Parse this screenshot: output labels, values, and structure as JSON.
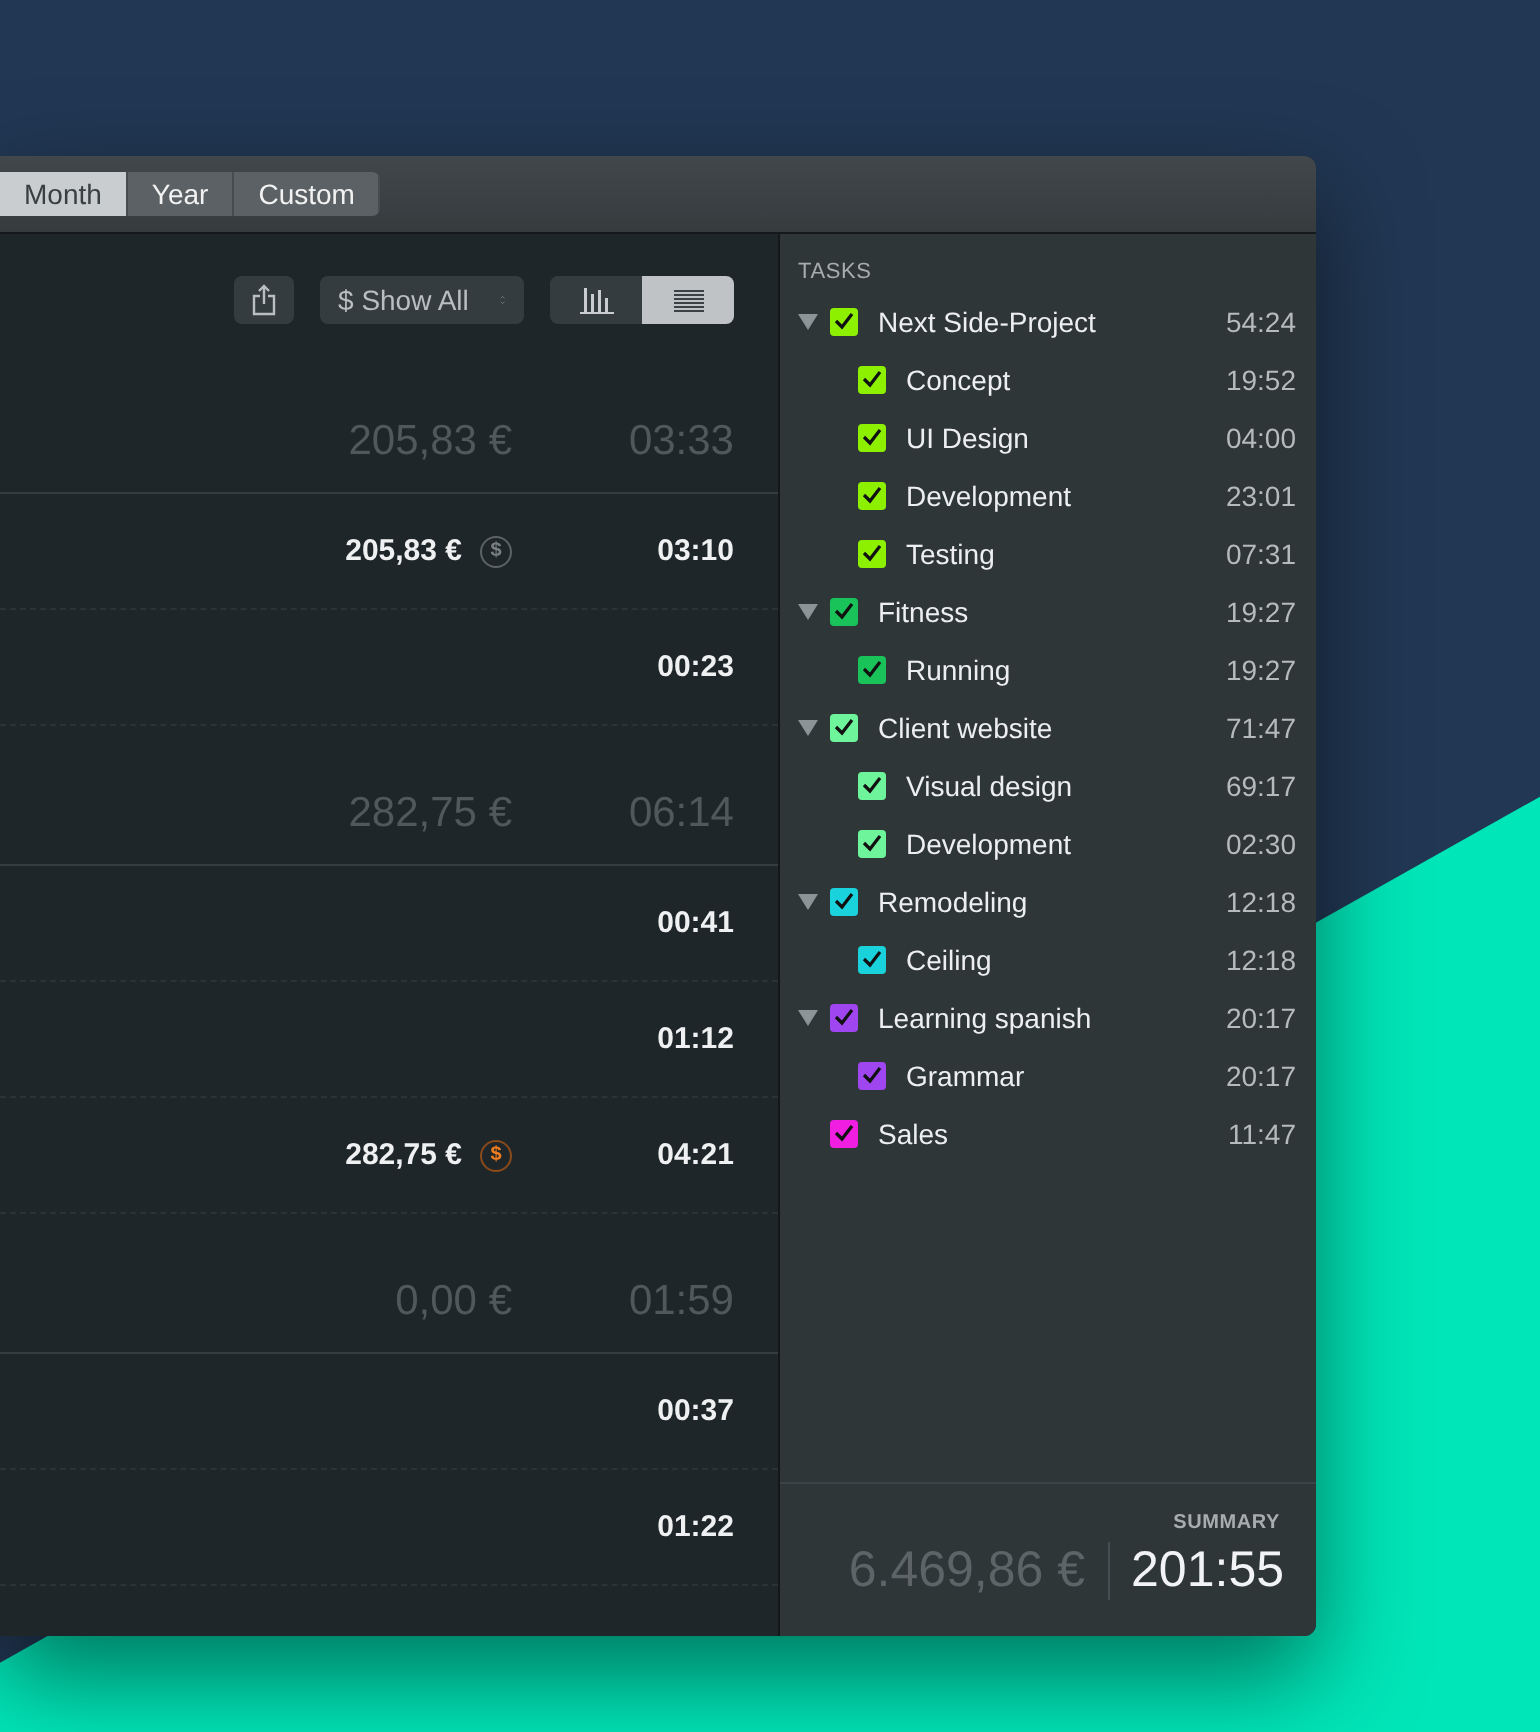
{
  "range_tabs": [
    {
      "label": "Month",
      "selected": true
    },
    {
      "label": "Year",
      "selected": false
    },
    {
      "label": "Custom",
      "selected": false
    }
  ],
  "toolbar": {
    "filter": {
      "symbol": "$",
      "label": "Show All"
    },
    "views": [
      {
        "kind": "chart",
        "selected": false
      },
      {
        "kind": "list",
        "selected": true
      }
    ]
  },
  "groups": [
    {
      "amount": "205,83 €",
      "duration": "03:33",
      "entries": [
        {
          "amount": "205,83 €",
          "coin": {
            "symbol": "$",
            "invoiced": false
          },
          "duration": "03:10"
        },
        {
          "duration": "00:23"
        }
      ]
    },
    {
      "amount": "282,75 €",
      "duration": "06:14",
      "entries": [
        {
          "duration": "00:41"
        },
        {
          "duration": "01:12"
        },
        {
          "amount": "282,75 €",
          "coin": {
            "symbol": "$",
            "invoiced": true
          },
          "duration": "04:21"
        }
      ]
    },
    {
      "amount": "0,00 €",
      "duration": "01:59",
      "entries": [
        {
          "duration": "00:37"
        },
        {
          "duration": "01:22"
        }
      ]
    }
  ],
  "tasks": {
    "heading": "TASKS",
    "items": [
      {
        "name": "Next Side-Project",
        "time": "54:24",
        "color": "#8cf000",
        "checked": true,
        "expanded": true,
        "children": [
          {
            "name": "Concept",
            "time": "19:52",
            "color": "#8cf000",
            "checked": true
          },
          {
            "name": "UI Design",
            "time": "04:00",
            "color": "#8cf000",
            "checked": true
          },
          {
            "name": "Development",
            "time": "23:01",
            "color": "#8cf000",
            "checked": true
          },
          {
            "name": "Testing",
            "time": "07:31",
            "color": "#8cf000",
            "checked": true
          }
        ]
      },
      {
        "name": "Fitness",
        "time": "19:27",
        "color": "#19c35a",
        "checked": true,
        "expanded": true,
        "children": [
          {
            "name": "Running",
            "time": "19:27",
            "color": "#19c35a",
            "checked": true
          }
        ]
      },
      {
        "name": "Client website",
        "time": "71:47",
        "color": "#6ef59b",
        "checked": true,
        "expanded": true,
        "children": [
          {
            "name": "Visual design",
            "time": "69:17",
            "color": "#6ef59b",
            "checked": true
          },
          {
            "name": "Development",
            "time": "02:30",
            "color": "#6ef59b",
            "checked": true
          }
        ]
      },
      {
        "name": "Remodeling",
        "time": "12:18",
        "color": "#19d2dc",
        "checked": true,
        "expanded": true,
        "children": [
          {
            "name": "Ceiling",
            "time": "12:18",
            "color": "#19d2dc",
            "checked": true
          }
        ]
      },
      {
        "name": "Learning spanish",
        "time": "20:17",
        "color": "#a046f0",
        "checked": true,
        "expanded": true,
        "children": [
          {
            "name": "Grammar",
            "time": "20:17",
            "color": "#a046f0",
            "checked": true
          }
        ]
      },
      {
        "name": "Sales",
        "time": "11:47",
        "color": "#f01ee1",
        "checked": true
      }
    ]
  },
  "summary": {
    "label": "SUMMARY",
    "amount": "6.469,86 €",
    "duration": "201:55"
  }
}
